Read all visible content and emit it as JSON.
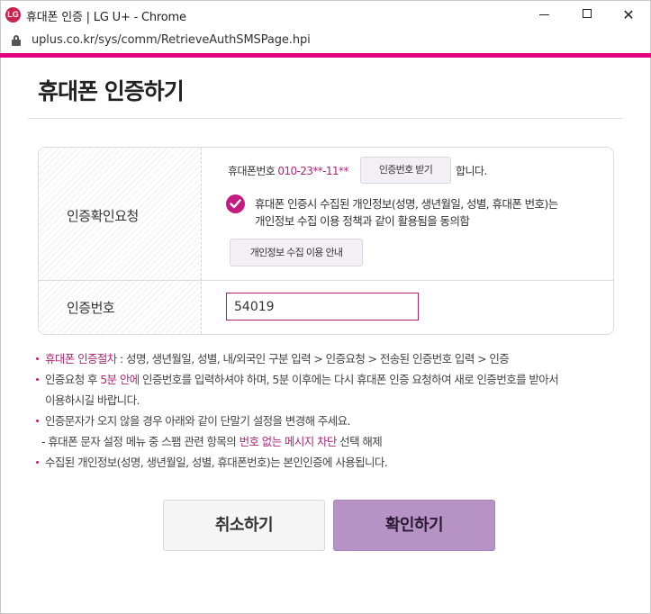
{
  "window": {
    "logo_text": "LG",
    "title": "휴대폰 인증 | LG U+ - Chrome",
    "minimize": "",
    "maximize": "",
    "close": "✕"
  },
  "browser": {
    "url": "uplus.co.kr/sys/comm/RetrieveAuthSMSPage.hpi"
  },
  "colors": {
    "accent": "#e3007f",
    "highlight": "#b1267a",
    "confirm_button": "#b793c5"
  },
  "page": {
    "title": "휴대폰 인증하기"
  },
  "form": {
    "request_label": "인증확인요청",
    "phone_prefix": "휴대폰번호",
    "phone_number": "010-23**-11**",
    "send_code_button": "인증번호 받기",
    "phone_suffix": "합니다.",
    "consent_text": "휴대폰 인증시 수집된 개인정보(성명, 생년월일, 성별, 휴대폰 번호)는 개인정보 수집 이용 정책과 같이 활용됨을 동의함",
    "consent_checked": true,
    "privacy_button": "개인정보 수집 이용 안내",
    "code_label": "인증번호",
    "code_value": "54019"
  },
  "notes": {
    "n1_hl": "휴대폰 인증절차",
    "n1_rest": " : 성명, 생년월일, 성별, 내/외국인 구분 입력 > 인증요청 > 전송된 인증번호 입력 > 인증",
    "n2_a": "인증요청 후 ",
    "n2_hl": "5분 안에",
    "n2_b": " 인증번호를 입력하셔야 하며, 5분 이후에는 다시 휴대폰 인증 요청하여 새로 인증번호를 받아서",
    "n2_c": "이용하시길 바랍니다.",
    "n3": "인증문자가 오지 않을 경우 아래와 같이 단말기 설정을 변경해 주세요.",
    "n3_sub_a": "- 휴대폰 문자 설정 메뉴 중 스팸 관련 항목의 ",
    "n3_sub_hl": "번호 없는 메시지 차단",
    "n3_sub_b": " 선택 해제",
    "n4": "수집된 개인정보(성명, 생년월일, 성별, 휴대폰번호)는 본인인증에 사용됩니다."
  },
  "actions": {
    "cancel": "취소하기",
    "confirm": "확인하기"
  }
}
